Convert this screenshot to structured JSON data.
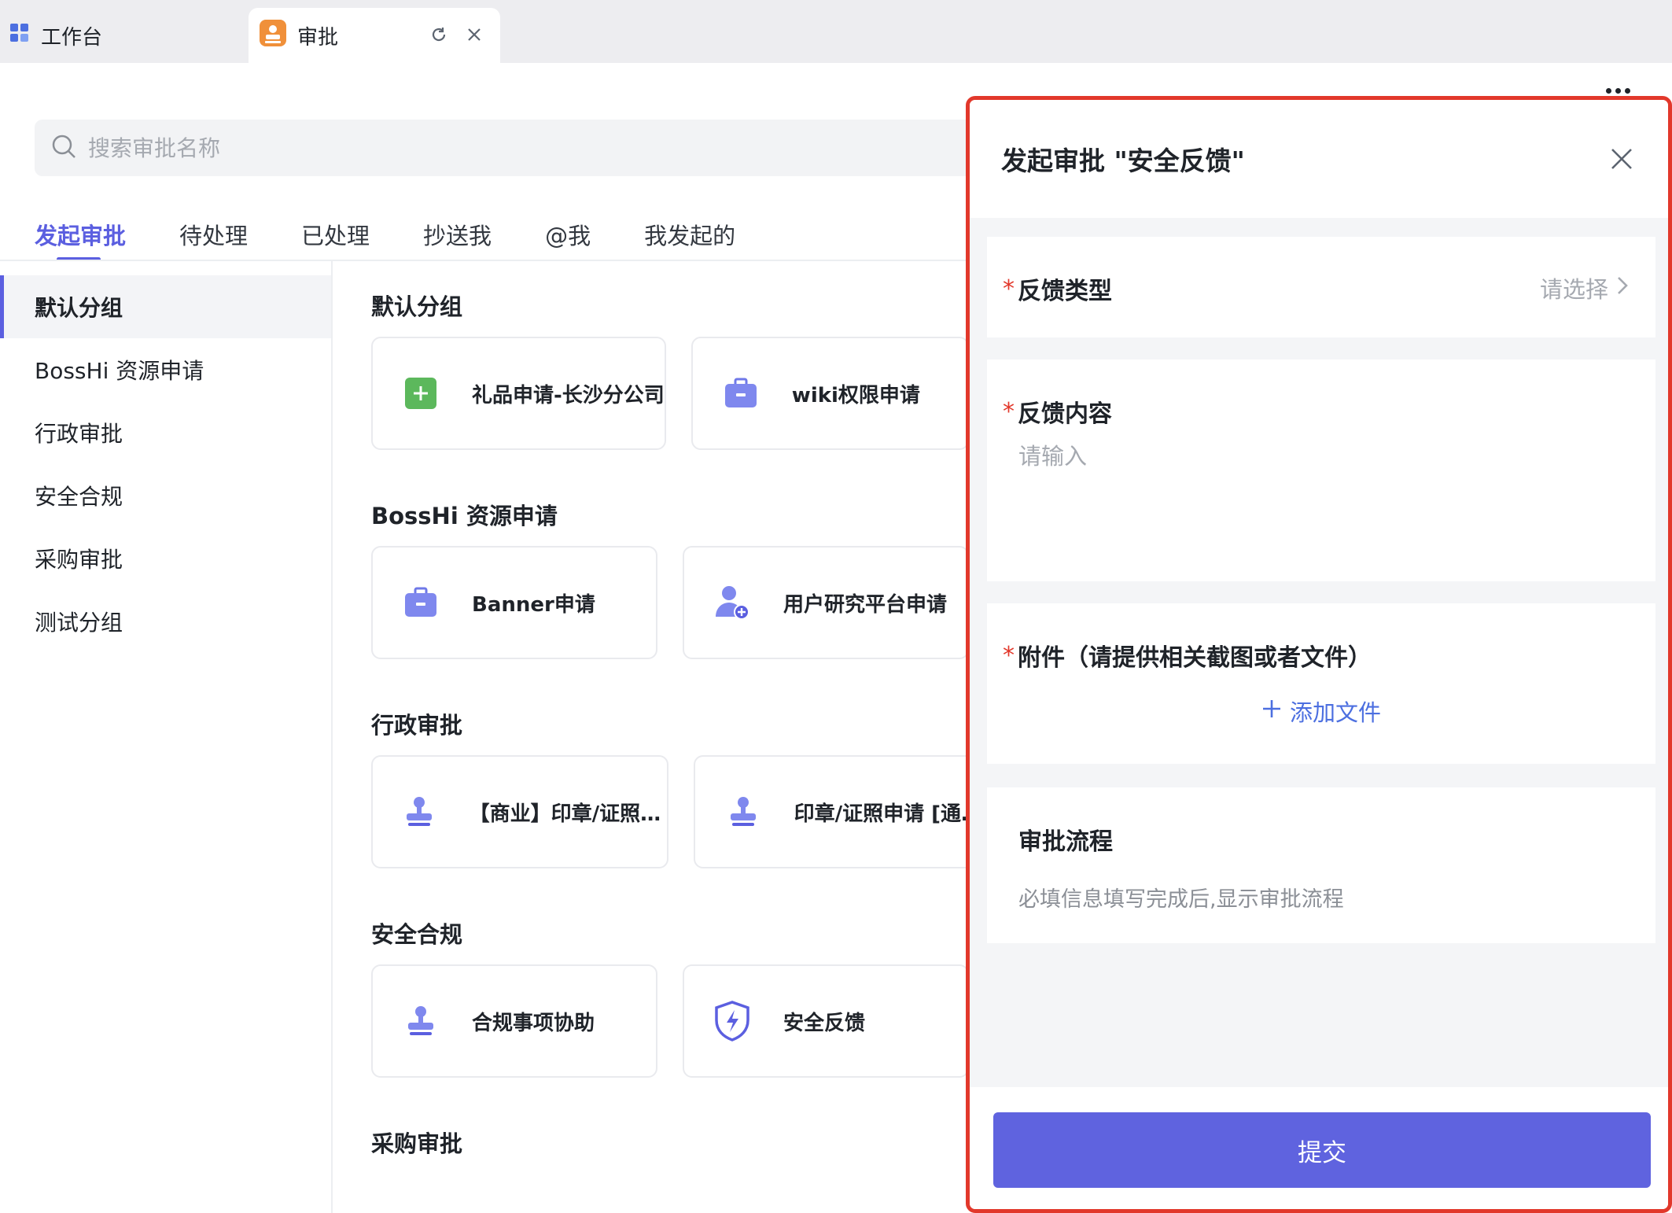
{
  "tabs": [
    {
      "label": "工作台",
      "icon": "grid-icon"
    },
    {
      "label": "审批",
      "icon": "stamp-app-icon"
    }
  ],
  "search": {
    "placeholder": "搜索审批名称"
  },
  "nav_tabs": [
    "发起审批",
    "待处理",
    "已处理",
    "抄送我",
    "@我",
    "我发起的"
  ],
  "sidebar": [
    "默认分组",
    "BossHi 资源申请",
    "行政审批",
    "安全合规",
    "采购审批",
    "测试分组"
  ],
  "groups": [
    {
      "title": "默认分组",
      "items": [
        {
          "label": "礼品申请-长沙分公司",
          "icon": "gift-icon"
        },
        {
          "label": "wiki权限申请",
          "icon": "briefcase-icon"
        }
      ]
    },
    {
      "title": "BossHi 资源申请",
      "items": [
        {
          "label": "Banner申请",
          "icon": "briefcase-icon"
        },
        {
          "label": "用户研究平台申请",
          "icon": "user-add-icon"
        }
      ]
    },
    {
      "title": "行政审批",
      "items": [
        {
          "label": "【商业】印章/证照申请",
          "icon": "stamp-icon"
        },
        {
          "label": "印章/证照申请 [通用]",
          "icon": "stamp-icon"
        }
      ]
    },
    {
      "title": "安全合规",
      "items": [
        {
          "label": "合规事项协助",
          "icon": "stamp-icon"
        },
        {
          "label": "安全反馈",
          "icon": "shield-bolt-icon"
        }
      ]
    },
    {
      "title": "采购审批",
      "items": []
    }
  ],
  "panel": {
    "title": "发起审批 \"安全反馈\"",
    "field_type": {
      "label": "反馈类型",
      "value": "请选择",
      "required": "*"
    },
    "field_content": {
      "label": "反馈内容",
      "placeholder": "请输入",
      "required": "*"
    },
    "field_attach": {
      "label": "附件（请提供相关截图或者文件）",
      "add": "添加文件",
      "required": "*"
    },
    "flow": {
      "title": "审批流程",
      "hint": "必填信息填写完成后,显示审批流程"
    },
    "submit": "提交"
  },
  "colors": {
    "accent": "#5b5fe0",
    "highlight_border": "#e2382b",
    "link": "#4c6fe0"
  }
}
